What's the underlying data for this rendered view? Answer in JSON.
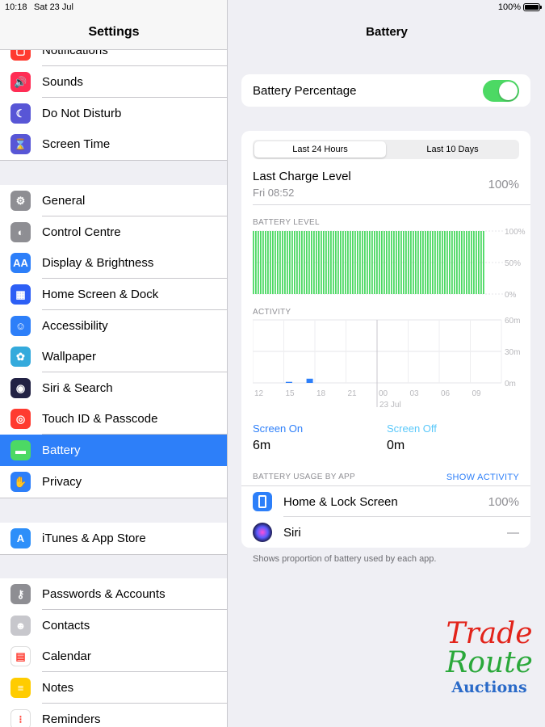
{
  "status": {
    "time": "10:18",
    "date": "Sat 23 Jul",
    "battery": "100%"
  },
  "sidebar": {
    "title": "Settings",
    "items": [
      {
        "label": "Notifications",
        "icon": "notifications-icon",
        "color": "#ff3b30",
        "glyph": "▢"
      },
      {
        "label": "Sounds",
        "icon": "speaker-icon",
        "color": "#ff2d55",
        "glyph": "🔊"
      },
      {
        "label": "Do Not Disturb",
        "icon": "moon-icon",
        "color": "#5856d6",
        "glyph": "☾"
      },
      {
        "label": "Screen Time",
        "icon": "hourglass-icon",
        "color": "#5856d6",
        "glyph": "⌛"
      },
      {
        "label": "General",
        "icon": "gear-icon",
        "color": "#8e8e93",
        "glyph": "⚙"
      },
      {
        "label": "Control Centre",
        "icon": "switches-icon",
        "color": "#8e8e93",
        "glyph": "◐"
      },
      {
        "label": "Display & Brightness",
        "icon": "text-size-icon",
        "color": "#2d7ff9",
        "glyph": "AA"
      },
      {
        "label": "Home Screen & Dock",
        "icon": "app-grid-icon",
        "color": "#2d5ff5",
        "glyph": "▦"
      },
      {
        "label": "Accessibility",
        "icon": "accessibility-icon",
        "color": "#2d7ff9",
        "glyph": "☺"
      },
      {
        "label": "Wallpaper",
        "icon": "flower-icon",
        "color": "#34aadc",
        "glyph": "✿"
      },
      {
        "label": "Siri & Search",
        "icon": "siri-icon",
        "color": "#222244",
        "glyph": "◉"
      },
      {
        "label": "Touch ID & Passcode",
        "icon": "fingerprint-icon",
        "color": "#ff3b30",
        "glyph": "◎"
      },
      {
        "label": "Battery",
        "icon": "battery-icon",
        "color": "#4cd964",
        "glyph": "▬"
      },
      {
        "label": "Privacy",
        "icon": "hand-icon",
        "color": "#2d7ff9",
        "glyph": "✋"
      },
      {
        "label": "iTunes & App Store",
        "icon": "app-store-icon",
        "color": "#2d8ff9",
        "glyph": "A"
      },
      {
        "label": "Passwords & Accounts",
        "icon": "key-icon",
        "color": "#8e8e93",
        "glyph": "⚷"
      },
      {
        "label": "Contacts",
        "icon": "contacts-icon",
        "color": "#c7c7cc",
        "glyph": "☻"
      },
      {
        "label": "Calendar",
        "icon": "calendar-icon",
        "color": "#ffffff",
        "glyph": "▤"
      },
      {
        "label": "Notes",
        "icon": "notes-icon",
        "color": "#ffcc00",
        "glyph": "≡"
      },
      {
        "label": "Reminders",
        "icon": "reminders-icon",
        "color": "#ffffff",
        "glyph": "⁝"
      }
    ]
  },
  "battery": {
    "title": "Battery",
    "percentage_label": "Battery Percentage",
    "percentage_on": true,
    "tabs": [
      "Last 24 Hours",
      "Last 10 Days"
    ],
    "last_charge_label": "Last Charge Level",
    "last_charge_time": "Fri 08:52",
    "last_charge_value": "100%",
    "level_title": "BATTERY LEVEL",
    "level_ticks": [
      "100%",
      "50%",
      "0%"
    ],
    "activity_title": "ACTIVITY",
    "activity_ticks": [
      "60m",
      "30m",
      "0m"
    ],
    "x_ticks": [
      "12",
      "15",
      "18",
      "21",
      "00",
      "03",
      "06",
      "09"
    ],
    "x_date": "23 Jul",
    "screen_on_label": "Screen On",
    "screen_on_value": "6m",
    "screen_off_label": "Screen Off",
    "screen_off_value": "0m",
    "usage_title": "BATTERY USAGE BY APP",
    "show_activity": "SHOW ACTIVITY",
    "apps": [
      {
        "name": "Home & Lock Screen",
        "value": "100%",
        "icon": "home-screen-icon"
      },
      {
        "name": "Siri",
        "value": "—",
        "icon": "siri-icon"
      }
    ],
    "footnote": "Shows proportion of battery used by each app."
  },
  "chart_data": [
    {
      "type": "bar",
      "title": "BATTERY LEVEL",
      "ylim": [
        0,
        100
      ],
      "yticks": [
        "100%",
        "50%",
        "0%"
      ],
      "series": [
        {
          "values": [
            100,
            100,
            100,
            100,
            100,
            100,
            100,
            100,
            100,
            100,
            100,
            100,
            100,
            100,
            100,
            100,
            100,
            100,
            100,
            100,
            100,
            100,
            100,
            100,
            100,
            100,
            100,
            100,
            100,
            100,
            100,
            100,
            100,
            100,
            100,
            100,
            100,
            100,
            100,
            100,
            100,
            100,
            100,
            100,
            100,
            100,
            100,
            100,
            100,
            100,
            100,
            100,
            100,
            100,
            100,
            100,
            100,
            100,
            100,
            100,
            100,
            100,
            100,
            100,
            100,
            100,
            100,
            100,
            100,
            100,
            100,
            100,
            100,
            100,
            100,
            100,
            100,
            100,
            100,
            100,
            100,
            100,
            100,
            100,
            100,
            100,
            100,
            100,
            100,
            100,
            100,
            100,
            100,
            100,
            100,
            100
          ],
          "color": "#4cd964"
        }
      ]
    },
    {
      "type": "bar",
      "title": "ACTIVITY",
      "ylim": [
        0,
        60
      ],
      "yticks": [
        "60m",
        "30m",
        "0m"
      ],
      "categories": [
        "12",
        "15",
        "18",
        "21",
        "00",
        "03",
        "06",
        "09"
      ],
      "series": [
        {
          "name": "Screen On",
          "color": "#2d7ff9",
          "bars": [
            {
              "hour": 15.5,
              "minutes": 1
            },
            {
              "hour": 17.5,
              "minutes": 4
            }
          ]
        }
      ]
    }
  ],
  "watermark": {
    "line1": "Trade",
    "line2": "Route",
    "line3": "Auctions"
  }
}
